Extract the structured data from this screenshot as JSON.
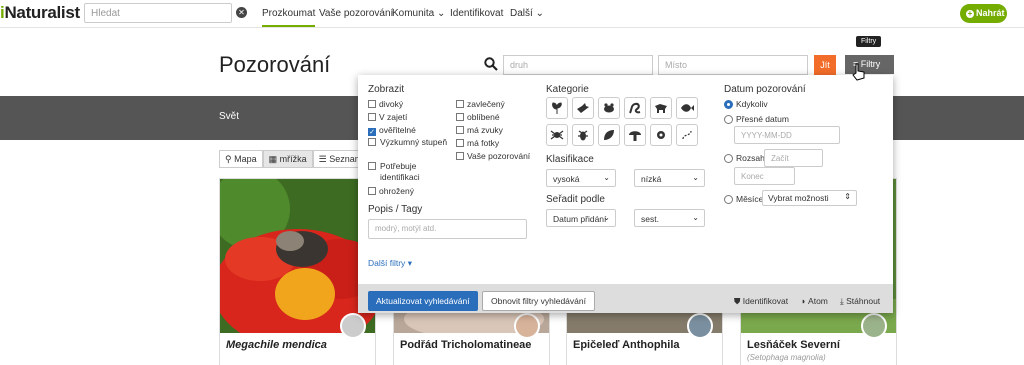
{
  "header": {
    "logo_prefix": "i",
    "logo_rest": "Naturalist",
    "search_placeholder": "Hledat",
    "nav": [
      "Prozkoumat",
      "Vaše pozorování",
      "Komunita",
      "Identifikovat",
      "Další"
    ],
    "upload_label": "Nahrát"
  },
  "page": {
    "title": "Pozorování",
    "species_placeholder": "druh",
    "place_placeholder": "Místo",
    "go_label": "Jít",
    "filters_label": "Filtry",
    "tooltip": "Filtry",
    "band_label": "Svět"
  },
  "view_tabs": [
    "Mapa",
    "mřížka",
    "Seznam"
  ],
  "cards": [
    {
      "name": "Megachile mendica",
      "sci": ""
    },
    {
      "name": "Podřád Tricholomatineae",
      "sci": ""
    },
    {
      "name": "Epičeleď Anthophila",
      "sci": ""
    },
    {
      "name": "Lesňáček Severní",
      "sci": "(Setophaga magnolia)"
    }
  ],
  "filters": {
    "show_heading": "Zobrazit",
    "show_col1": [
      "divoký",
      "V zajetí",
      "ověřitelné",
      "Výzkumný stupeň",
      "Potřebuje identifikaci",
      "ohrožený"
    ],
    "show_col1_checked": [
      false,
      false,
      true,
      false,
      false,
      false
    ],
    "show_col2": [
      "zavlečený",
      "oblíbené",
      "má zvuky",
      "má fotky",
      "Vaše pozorování"
    ],
    "desc_heading": "Popis / Tagy",
    "desc_placeholder": "modrý, motýl atd.",
    "more_filters": "Další filtry",
    "category_heading": "Kategorie",
    "classification_heading": "Klasifikace",
    "class_high": "vysoká",
    "class_low": "nízká",
    "sort_heading": "Seřadit podle",
    "sort_by": "Datum přidání",
    "sort_dir": "sest.",
    "date_heading": "Datum pozorování",
    "date_any": "Kdykoliv",
    "date_exact": "Přesné datum",
    "date_placeholder": "YYYY-MM-DD",
    "date_range": "Rozsah",
    "range_start": "Začít",
    "range_end": "Konec",
    "months": "Měsíce",
    "months_select": "Vybrat možnosti",
    "update_button": "Aktualizovat vyhledávání",
    "reset_button": "Obnovit filtry vyhledávání",
    "link_identify": "Identifikovat",
    "link_atom": "Atom",
    "link_download": "Stáhnout"
  },
  "colors": {
    "brand": "#74ac00",
    "primary": "#2a6ebb",
    "go": "#f36d2a"
  }
}
